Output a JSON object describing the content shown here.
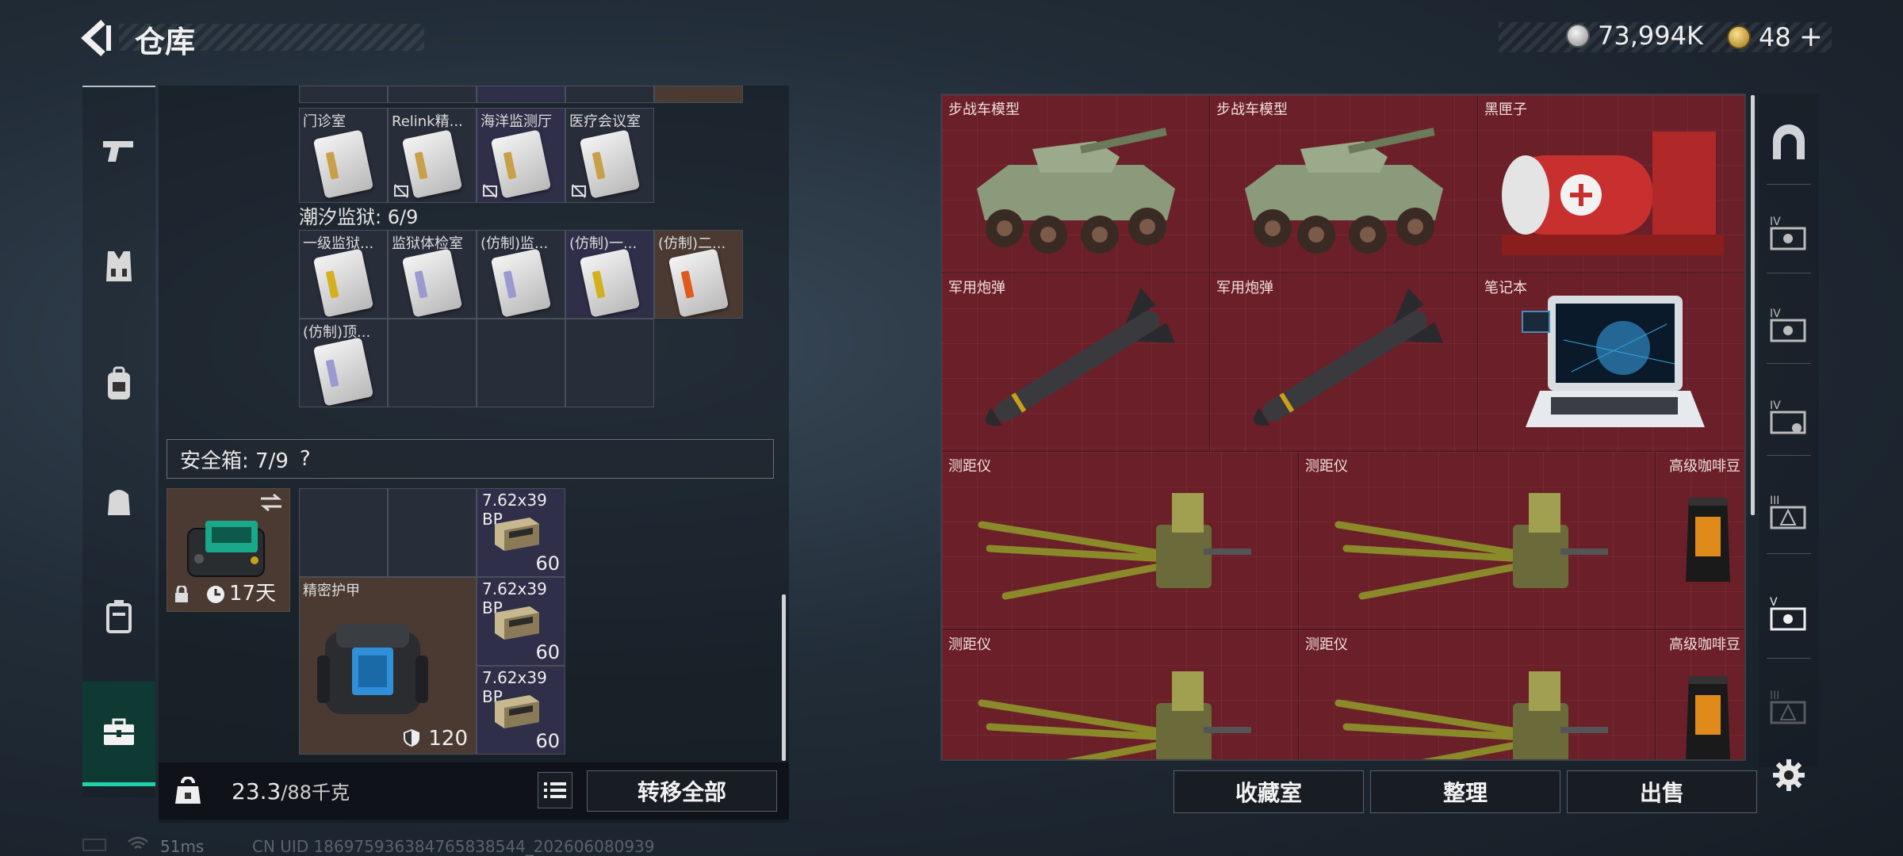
{
  "header": {
    "title": "仓库",
    "currency_amount": "73,994K",
    "premium_amount": "48",
    "premium_plus": "+",
    "colors": {
      "coin": "#c9c9c9",
      "premium_coin": "#d8b24a"
    }
  },
  "left_rail": {
    "items": [
      {
        "icon": "pistol-icon"
      },
      {
        "icon": "armor-vest-icon"
      },
      {
        "icon": "backpack-icon"
      },
      {
        "icon": "bag-icon"
      },
      {
        "icon": "canister-icon"
      },
      {
        "icon": "toolbox-icon",
        "active": true
      }
    ]
  },
  "storage": {
    "top_row_labels": [
      "门诊室",
      "Relink精...",
      "海洋监测厅",
      "医疗会议室"
    ],
    "prison_title": "潮汐监狱: 6/9",
    "prison_row1": [
      "一级监狱...",
      "监狱体检室",
      "(仿制)监...",
      "(仿制)一...",
      "(仿制)二..."
    ],
    "prison_row2": [
      "(仿制)顶..."
    ],
    "safebox_title": "安全箱: 7/9",
    "safebox_help": "?",
    "safebox_timer": "17天",
    "armor_label": "精密护甲",
    "armor_value": "120",
    "ammo": [
      {
        "name": "7.62x39",
        "sub": "BP",
        "count": "60"
      },
      {
        "name": "7.62x39",
        "sub": "BP",
        "count": "60"
      },
      {
        "name": "7.62x39",
        "sub": "BP",
        "count": "60"
      }
    ]
  },
  "footer_left": {
    "weight": "23.3",
    "weight_max": "/88千克",
    "transfer_all": "转移全部"
  },
  "collection": {
    "row1": [
      "步战车模型",
      "步战车模型",
      "黑匣子"
    ],
    "row2": [
      "军用炮弹",
      "军用炮弹",
      "笔记本"
    ],
    "row3": [
      "测距仪",
      "测距仪",
      "高级咖啡豆"
    ],
    "row4": [
      "测距仪",
      "测距仪",
      "高级咖啡豆"
    ],
    "colors": {
      "panel": "#6b1f28"
    }
  },
  "footer_right": {
    "collection_room": "收藏室",
    "sort": "整理",
    "sell": "出售"
  },
  "status": {
    "ping": "51ms",
    "uid": "CN UID 186975936384765838544_202606080939"
  }
}
